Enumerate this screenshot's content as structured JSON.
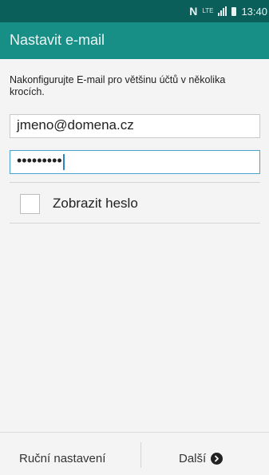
{
  "status_bar": {
    "nfc": "N",
    "network": "LTE",
    "time": "13:40"
  },
  "header": {
    "title": "Nastavit e-mail"
  },
  "form": {
    "description": "Nakonfigurujte E-mail pro většinu účtů v několika krocích.",
    "email_value": "jmeno@domena.cz",
    "password_mask": "•••••••••",
    "show_password_label": "Zobrazit heslo",
    "show_password_checked": false
  },
  "footer": {
    "manual_label": "Ruční nastavení",
    "next_label": "Další"
  },
  "colors": {
    "status_bar": "#0b5f5a",
    "action_bar": "#178e86",
    "focus": "#4aa0cf"
  }
}
